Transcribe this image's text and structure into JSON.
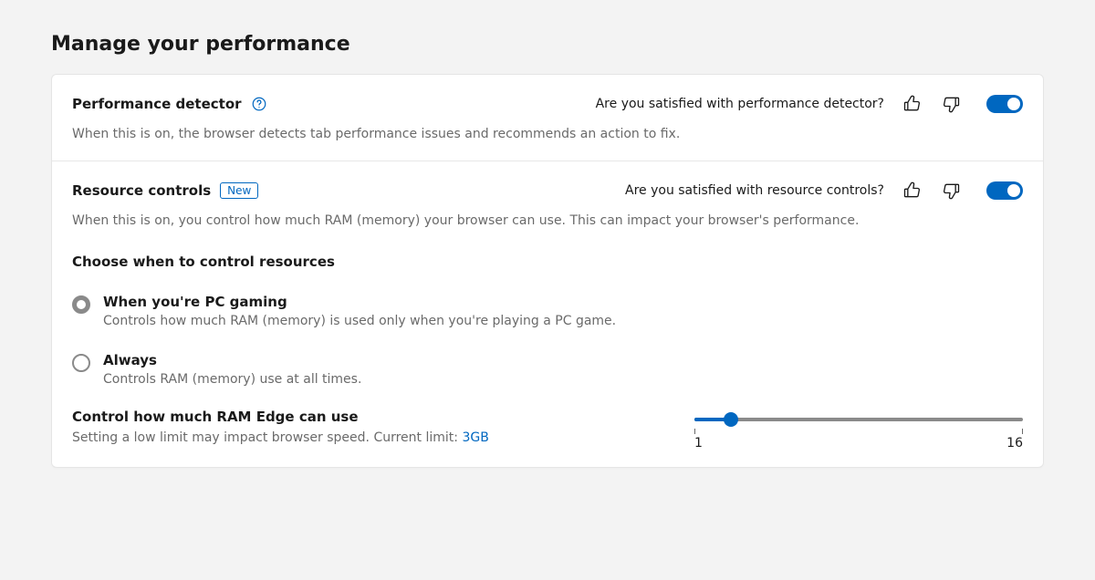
{
  "page": {
    "title": "Manage your performance"
  },
  "perf_detector": {
    "title": "Performance detector",
    "feedback_prompt": "Are you satisfied with performance detector?",
    "description": "When this is on, the browser detects tab performance issues and recommends an action to fix.",
    "toggle_on": true
  },
  "resource_controls": {
    "title": "Resource controls",
    "badge": "New",
    "feedback_prompt": "Are you satisfied with resource controls?",
    "description": "When this is on, you control how much RAM (memory) your browser can use. This can impact your browser's performance.",
    "toggle_on": true,
    "choose_title": "Choose when to control resources",
    "options": [
      {
        "label": "When you're PC gaming",
        "desc": "Controls how much RAM (memory) is used only when you're playing a PC game.",
        "selected": true
      },
      {
        "label": "Always",
        "desc": "Controls RAM (memory) use at all times.",
        "selected": false
      }
    ],
    "ram": {
      "title": "Control how much RAM Edge can use",
      "desc_prefix": "Setting a low limit may impact browser speed. Current limit: ",
      "current_limit": "3GB",
      "min_label": "1",
      "max_label": "16",
      "min": 1,
      "max": 16,
      "value": 3
    }
  }
}
